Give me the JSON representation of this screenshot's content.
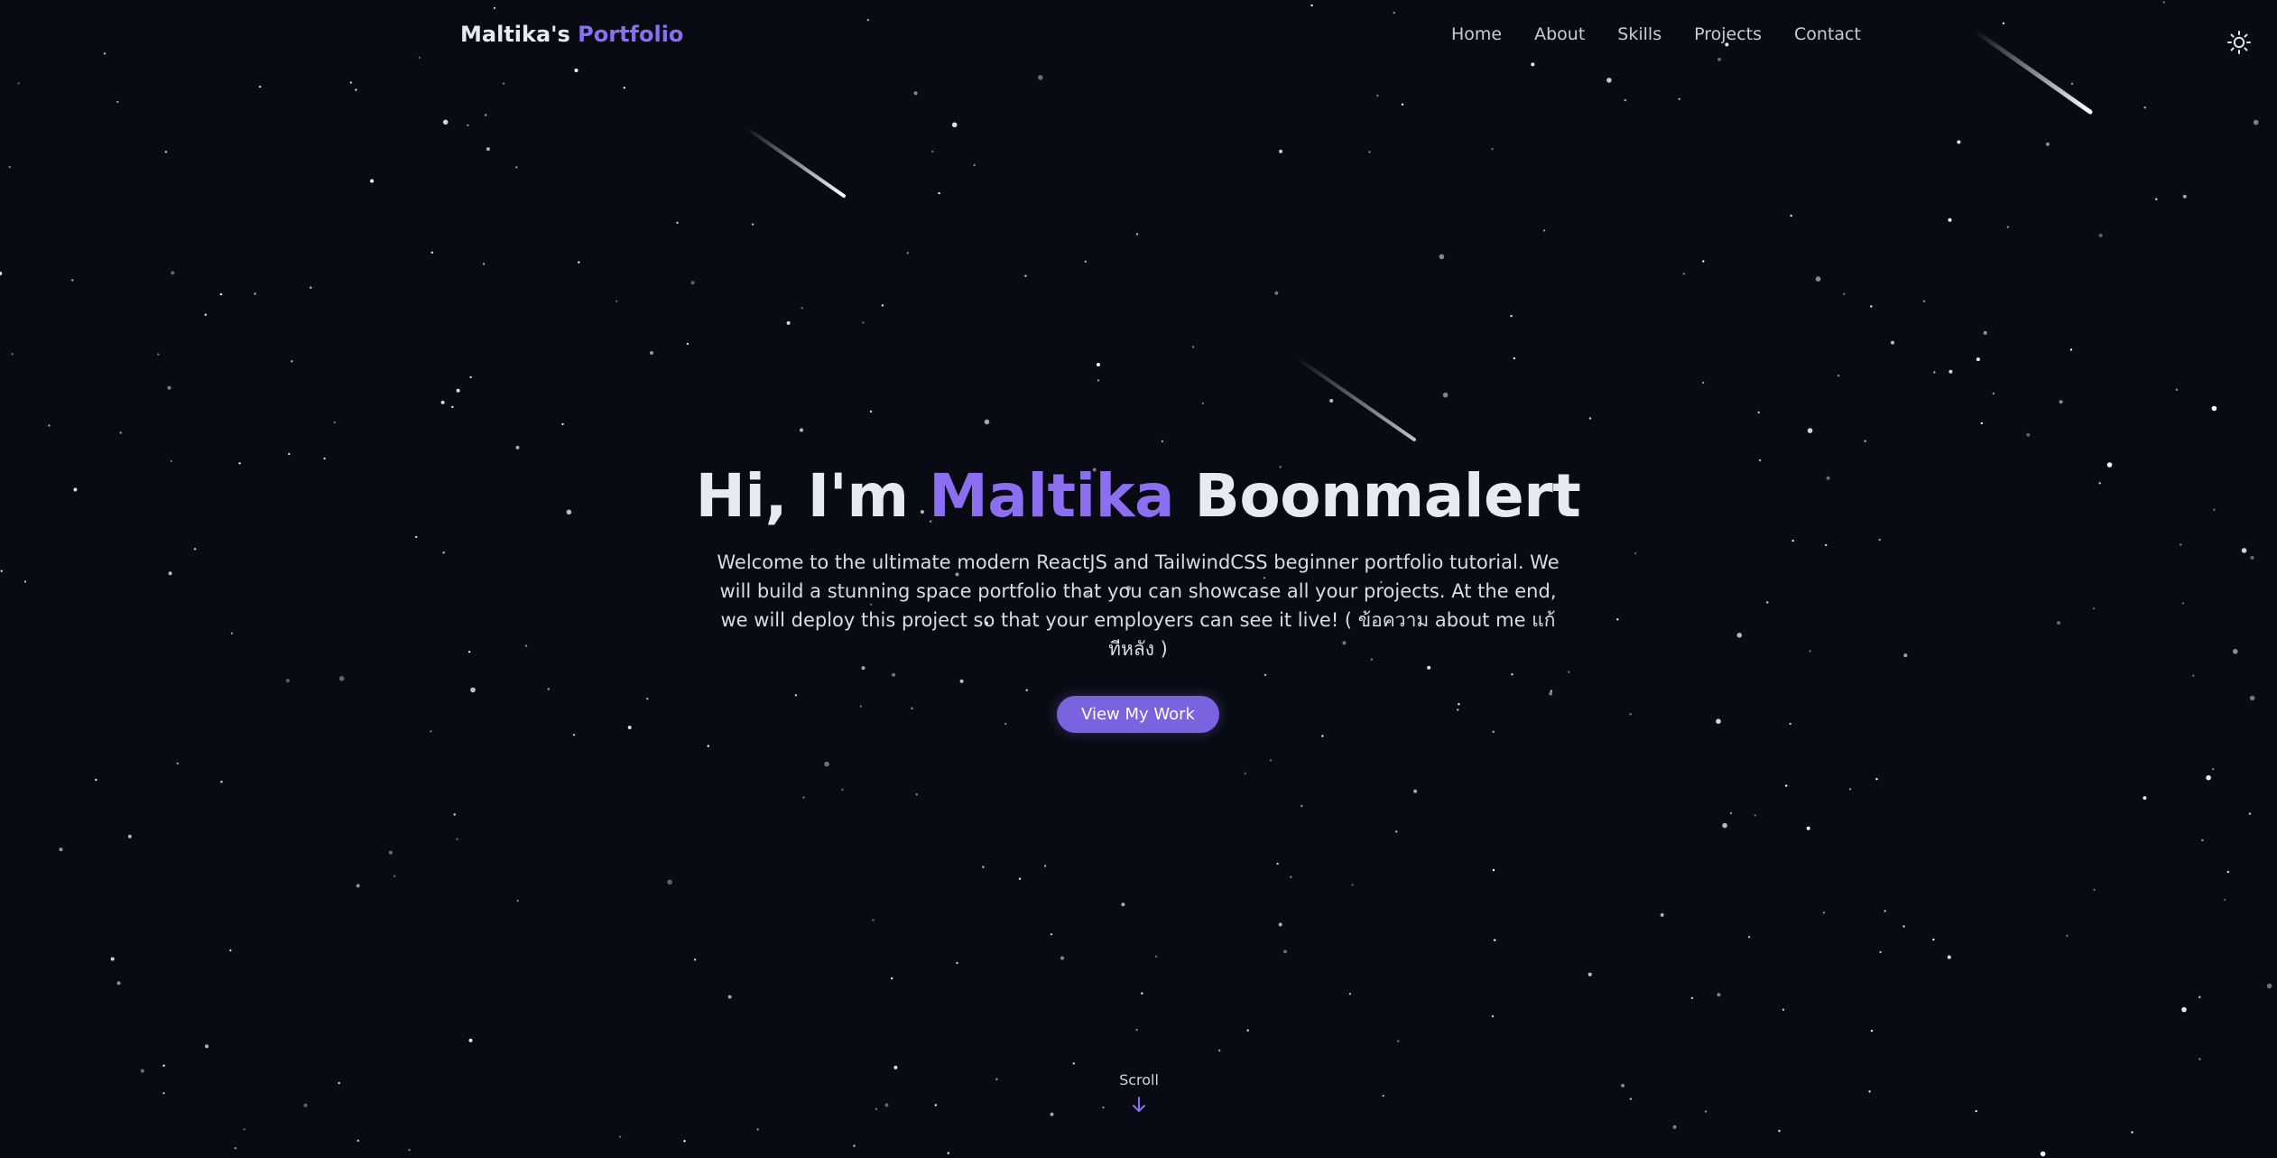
{
  "nav": {
    "brand_name": "Maltika's",
    "brand_accent": "Portfolio",
    "links": [
      "Home",
      "About",
      "Skills",
      "Projects",
      "Contact"
    ],
    "theme_icon": "sun-icon"
  },
  "hero": {
    "greeting": "Hi, I'm",
    "first_name": "Maltika",
    "last_name": "Boonmalert",
    "description": "Welcome to the ultimate modern ReactJS and TailwindCSS beginner portfolio tutorial. We will build a stunning space portfolio that you can showcase all your projects. At the end, we will deploy this project so that your employers can see it live! ( ข้อความ about me แก้ทีหลัง )",
    "cta_label": "View My Work"
  },
  "scroll": {
    "label": "Scroll",
    "icon": "arrow-down-icon"
  },
  "colors": {
    "background": "#080b13",
    "accent": "#8b6ff0",
    "button": "#7b63e0",
    "text": "#e8eaf2"
  }
}
